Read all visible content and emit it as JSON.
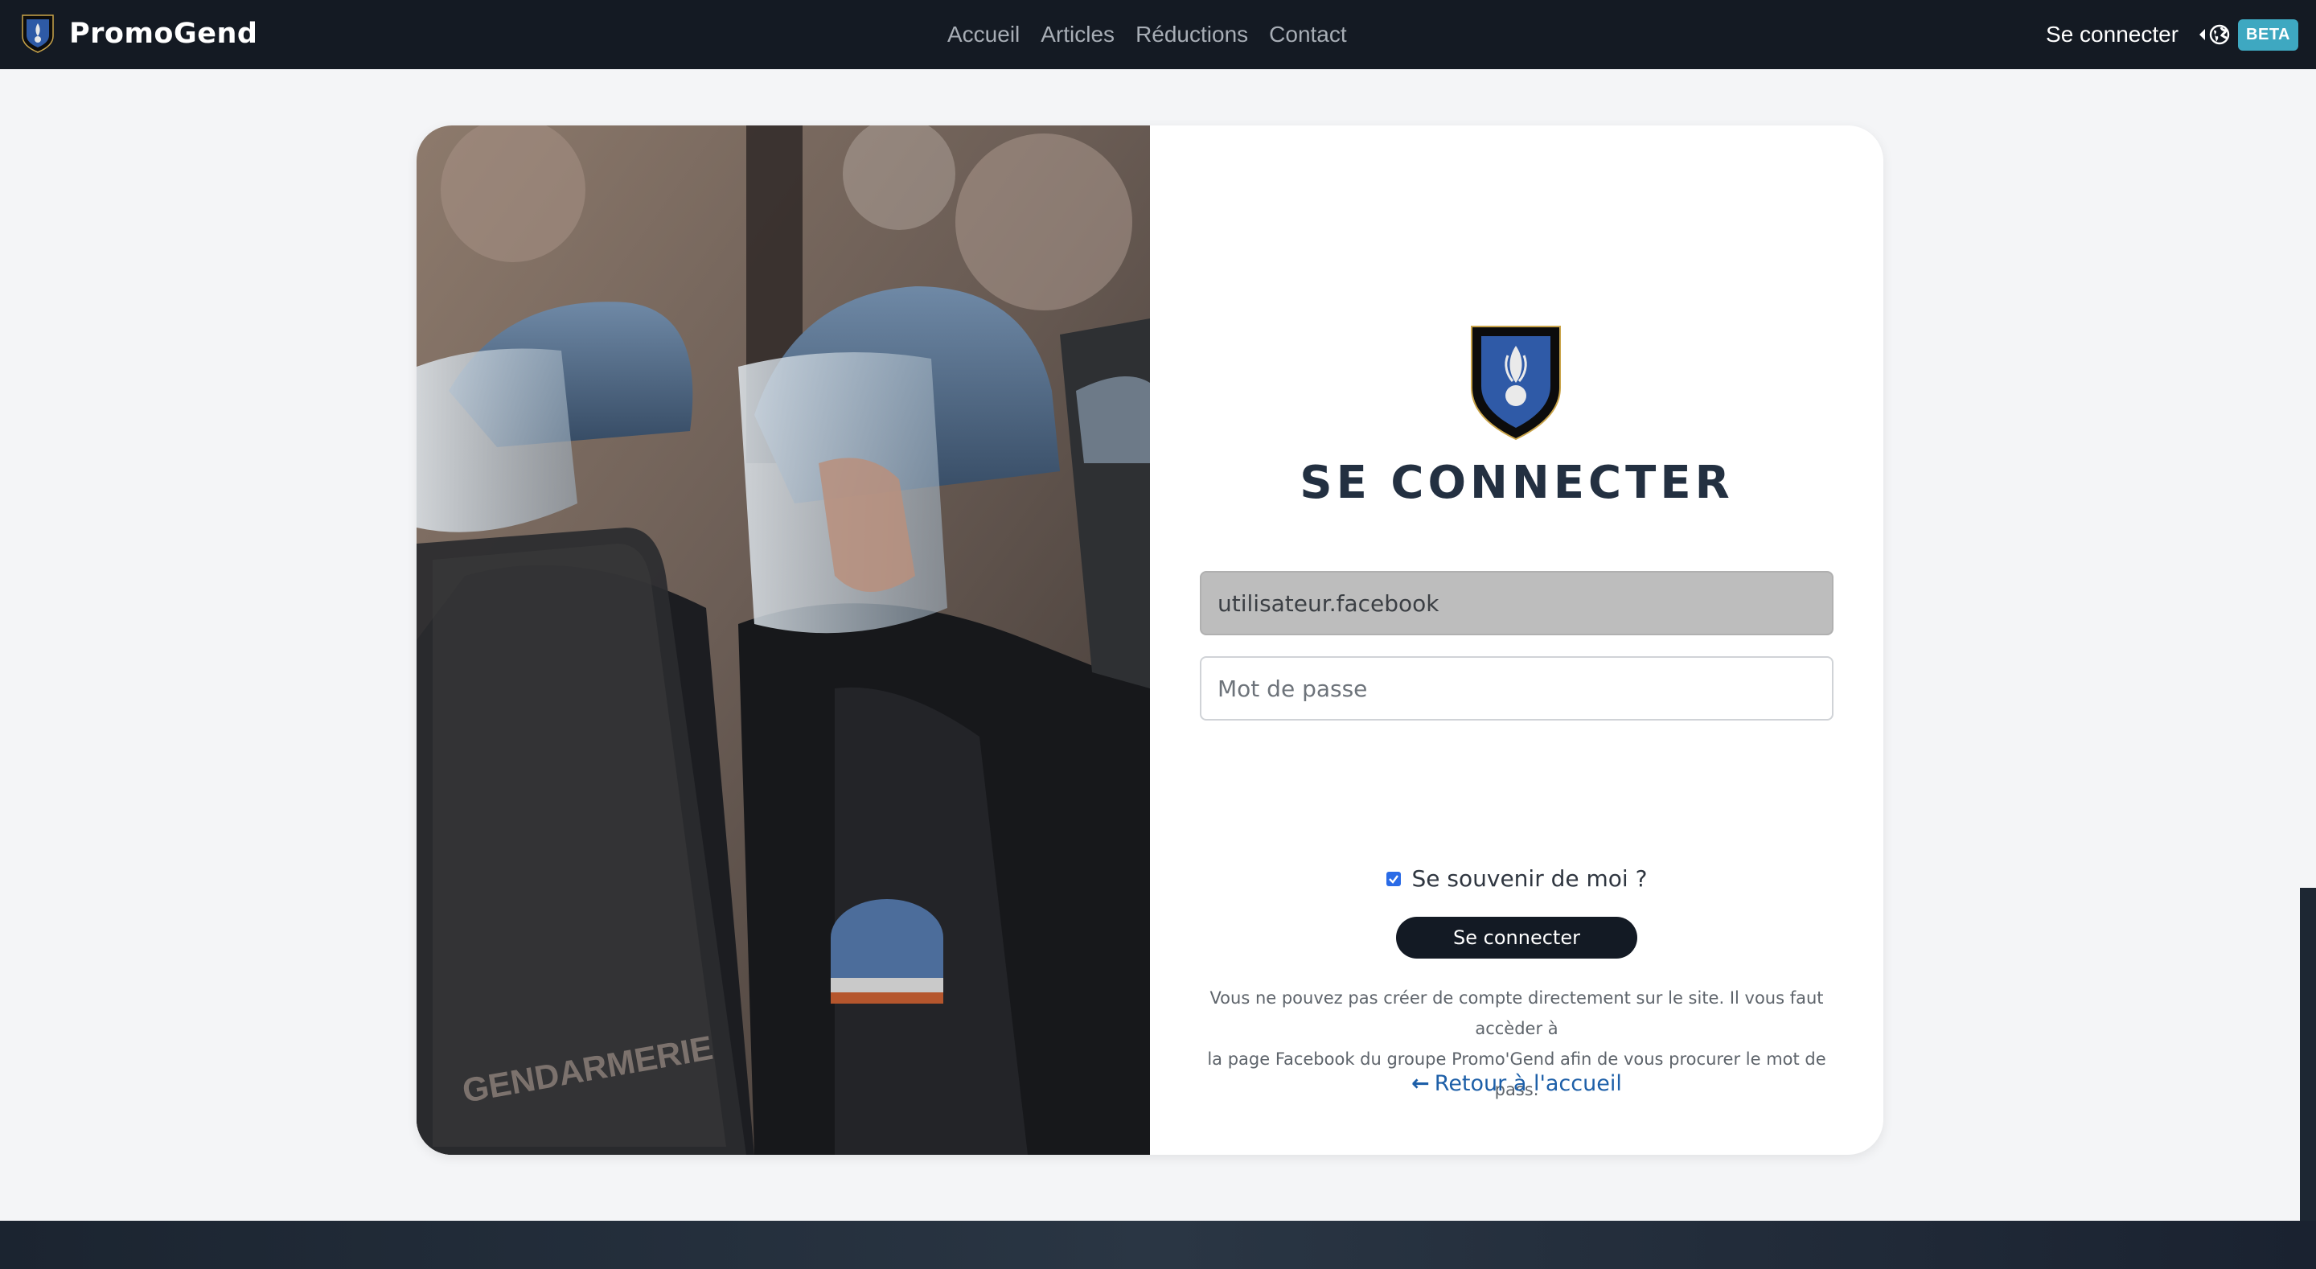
{
  "navbar": {
    "brand": "PromoGend",
    "links": [
      "Accueil",
      "Articles",
      "Réductions",
      "Contact"
    ],
    "login": "Se connecter",
    "badge": "BETA"
  },
  "login": {
    "title": "SE CONNECTER",
    "username_value": "utilisateur.facebook",
    "password_placeholder": "Mot de passe",
    "remember_label": "Se souvenir de moi ?",
    "remember_checked": true,
    "submit_label": "Se connecter",
    "info_line1": "Vous ne pouvez pas créer de compte directement sur le site. Il vous faut accèder à",
    "info_line2": "la page Facebook du groupe Promo'Gend afin de vous procurer le mot de pass.",
    "back_label": "Retour à l'accueil"
  },
  "photo": {
    "caption": "GENDARMERIE"
  },
  "colors": {
    "navbar_bg": "#141a23",
    "beta_badge": "#3ea8c1",
    "title_text": "#233041",
    "button_bg": "#131a24",
    "link": "#1d5fa8",
    "page_bg": "#f4f5f7"
  }
}
